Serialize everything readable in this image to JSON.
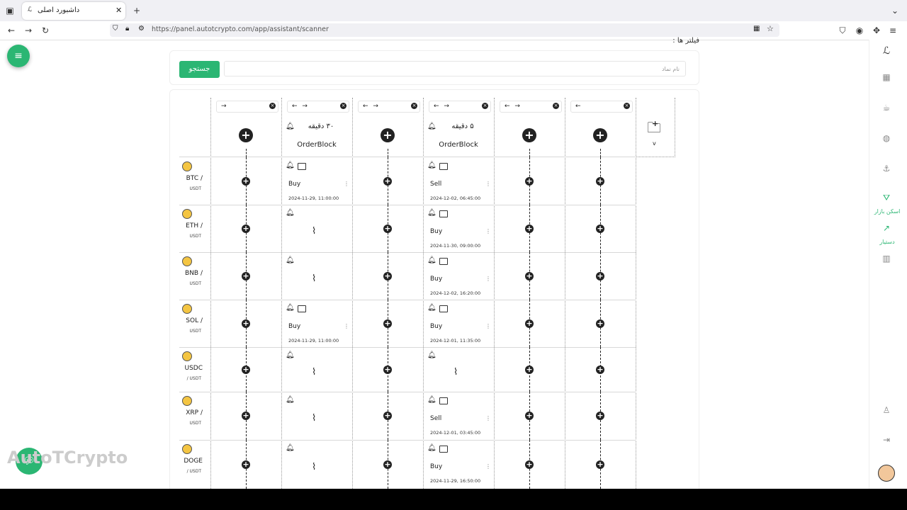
{
  "browser": {
    "tab_title": "داشبورد اصلی",
    "url": "https://panel.autotcrypto.com/app/assistant/scanner"
  },
  "filters": {
    "title": "فیلتر ها :",
    "search_button": "جستجو",
    "search_placeholder": "نام نماد"
  },
  "columns": [
    {
      "arrows": "→",
      "filled": false
    },
    {
      "arrows": "← →",
      "filled": true,
      "timeframe": "۳۰ دقیقه",
      "indicator": "OrderBlock"
    },
    {
      "arrows": "← →",
      "filled": false
    },
    {
      "arrows": "← →",
      "filled": true,
      "timeframe": "۵ دقیقه",
      "indicator": "OrderBlock"
    },
    {
      "arrows": "← →",
      "filled": false
    },
    {
      "arrows": "←",
      "filled": false
    }
  ],
  "add_column_label": "v",
  "rows": [
    {
      "base": "BTC /",
      "quote": "USDT",
      "c1": {
        "signal": "Buy",
        "time": "2024-11-29, 11:00:00"
      },
      "c3": {
        "signal": "Sell",
        "time": "2024-12-02, 06:45:00"
      }
    },
    {
      "base": "ETH /",
      "quote": "USDT",
      "c1": null,
      "c3": {
        "signal": "Buy",
        "time": "2024-11-30, 09:00:00"
      }
    },
    {
      "base": "BNB /",
      "quote": "USDT",
      "c1": null,
      "c3": {
        "signal": "Buy",
        "time": "2024-12-02, 16:20:00"
      }
    },
    {
      "base": "SOL /",
      "quote": "USDT",
      "c1": {
        "signal": "Buy",
        "time": "2024-11-29, 11:00:00"
      },
      "c3": {
        "signal": "Buy",
        "time": "2024-12-01, 11:35:00"
      }
    },
    {
      "base": "USDC",
      "quote": "/ USDT",
      "c1": null,
      "c3": null
    },
    {
      "base": "XRP /",
      "quote": "USDT",
      "c1": null,
      "c3": {
        "signal": "Sell",
        "time": "2024-12-01, 03:45:00"
      }
    },
    {
      "base": "DOGE",
      "quote": "/ USDT",
      "c1": null,
      "c3": {
        "signal": "Buy",
        "time": "2024-11-29, 16:50:00"
      }
    }
  ],
  "sidebar": {
    "scan_label": "اسکن بازار",
    "assistant_label": "دستیار"
  },
  "watermark": "AutoTCrypto",
  "colors": {
    "accent": "#2bb673"
  }
}
